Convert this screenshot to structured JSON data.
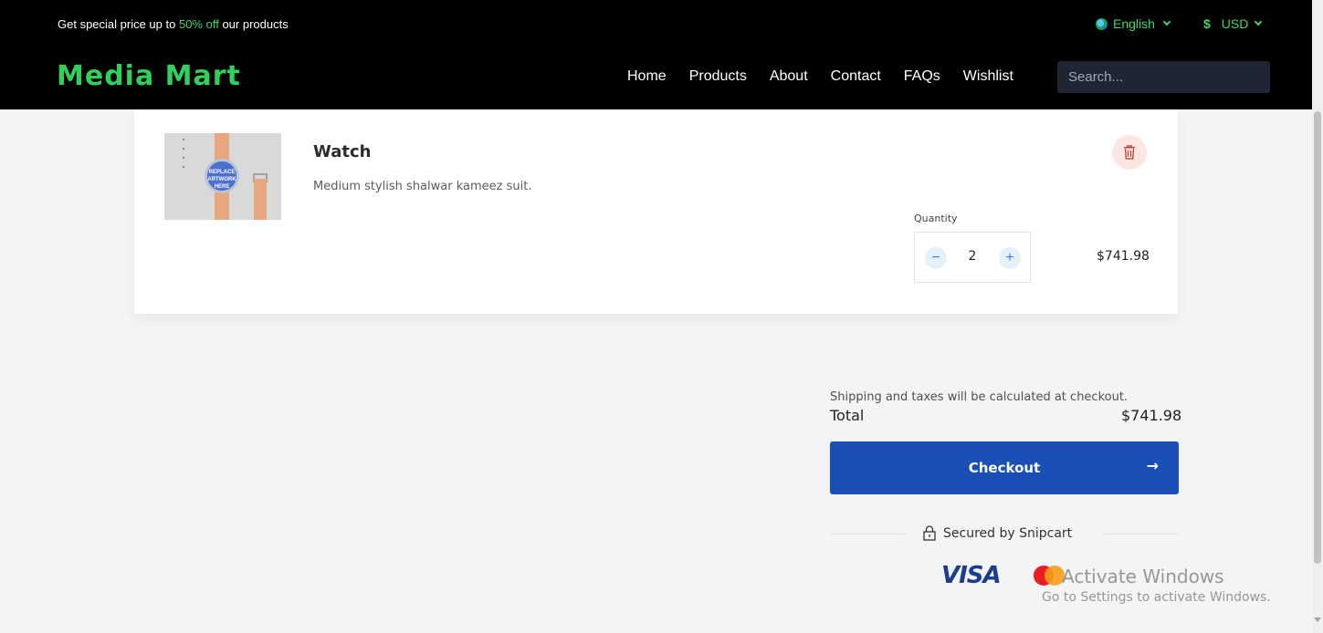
{
  "topbar": {
    "promo_prefix": "Get special price up to ",
    "promo_highlight": "50% off",
    "promo_suffix": " our products",
    "language": "English",
    "currency_symbol": "$",
    "currency": "USD"
  },
  "header": {
    "brand": "Media Mart",
    "nav": [
      "Home",
      "Products",
      "About",
      "Contact",
      "FAQs",
      "Wishlist"
    ],
    "search_placeholder": "Search..."
  },
  "cart": {
    "item": {
      "image_text": "REPLACE ARTWORK HERE",
      "name": "Watch",
      "description": "Medium stylish shalwar kameez suit.",
      "quantity_label": "Quantity",
      "quantity": "2",
      "price": "$741.98"
    },
    "summary": {
      "shipping_note": "Shipping and taxes will be calculated at checkout.",
      "total_label": "Total",
      "total_value": "$741.98",
      "checkout_label": "Checkout",
      "checkout_arrow": "→",
      "secured_text": "Secured by Snipcart",
      "visa": "VISA"
    }
  },
  "watermark": {
    "line1": "Activate Windows",
    "line2": "Go to Settings to activate Windows."
  },
  "colors": {
    "accent_green": "#2fd05c",
    "checkout_blue": "#1a4fb6",
    "trash_bg": "#fbe6e2"
  }
}
